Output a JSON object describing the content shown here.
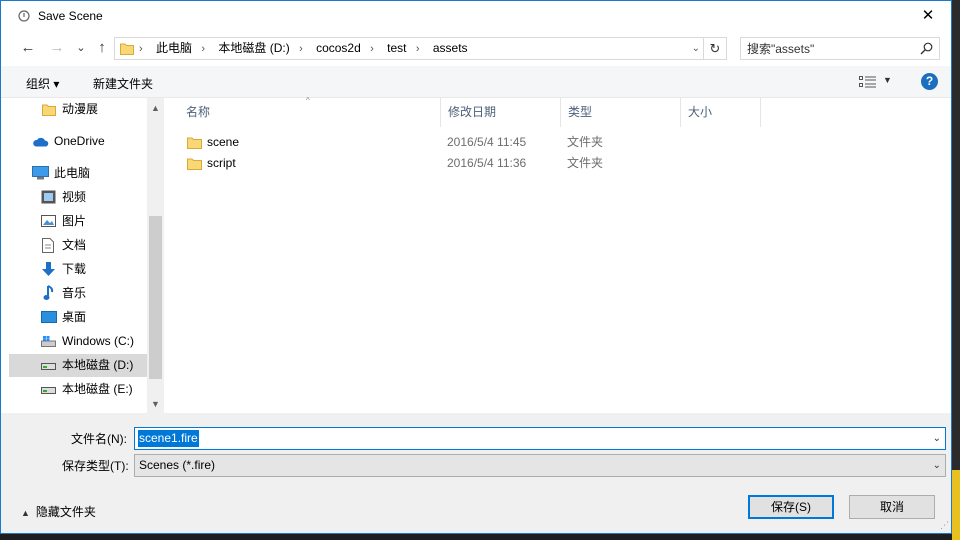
{
  "window": {
    "title": "Save Scene",
    "close_symbol": "✕"
  },
  "nav_buttons": {
    "back": "←",
    "forward": "→",
    "recent": "⌄",
    "up": "↑"
  },
  "address": {
    "crumbs": [
      "此电脑",
      "本地磁盘 (D:)",
      "cocos2d",
      "test",
      "assets"
    ],
    "dropdown": "⌄",
    "refresh": "↻"
  },
  "search": {
    "placeholder": "搜索\"assets\""
  },
  "toolbar": {
    "organize": "组织 ▾",
    "new_folder": "新建文件夹",
    "view_dd": "▼",
    "help": "?"
  },
  "sidebar": {
    "items": [
      {
        "label": "动漫展",
        "icon": "folder-icon"
      },
      {
        "label": "OneDrive",
        "icon": "cloud-icon"
      },
      {
        "label": "此电脑",
        "icon": "computer-icon"
      },
      {
        "label": "视频",
        "icon": "video-icon"
      },
      {
        "label": "图片",
        "icon": "picture-icon"
      },
      {
        "label": "文档",
        "icon": "document-icon"
      },
      {
        "label": "下载",
        "icon": "download-icon"
      },
      {
        "label": "音乐",
        "icon": "music-icon"
      },
      {
        "label": "桌面",
        "icon": "desktop-icon"
      },
      {
        "label": "Windows (C:)",
        "icon": "windows-drive-icon"
      },
      {
        "label": "本地磁盘 (D:)",
        "icon": "drive-icon",
        "selected": true
      },
      {
        "label": "本地磁盘 (E:)",
        "icon": "drive-icon"
      }
    ],
    "scroll_up": "▲",
    "scroll_down": "▼"
  },
  "columns": {
    "name": "名称",
    "modified": "修改日期",
    "type": "类型",
    "size": "大小",
    "sort_indicator": "^"
  },
  "files": [
    {
      "name": "scene",
      "modified": "2016/5/4 11:45",
      "type": "文件夹"
    },
    {
      "name": "script",
      "modified": "2016/5/4 11:36",
      "type": "文件夹"
    }
  ],
  "form": {
    "filename_label": "文件名(N):",
    "filename_value": "scene1.fire",
    "filetype_label": "保存类型(T):",
    "filetype_value": "Scenes (*.fire)",
    "dropdown": "⌄"
  },
  "footer": {
    "hide_folders": "隐藏文件夹",
    "hide_chevron": "▲",
    "save": "保存(S)",
    "cancel": "取消"
  },
  "colors": {
    "accent": "#0078d7",
    "folder": "#f4c95d",
    "selected_nav": "#d9d9d9"
  }
}
